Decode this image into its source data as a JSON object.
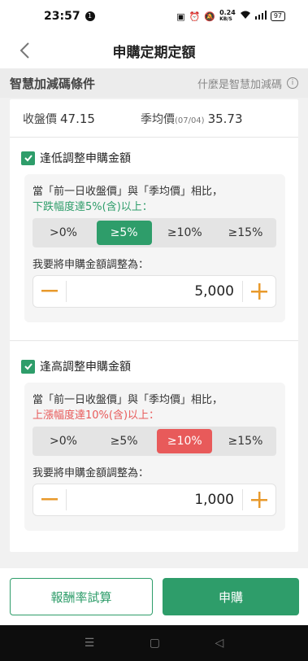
{
  "status_bar": {
    "time": "23:57",
    "notification_count": "1",
    "net_speed_value": "0.24",
    "net_speed_unit": "KB/S",
    "battery": "97"
  },
  "header": {
    "title": "申購定期定額"
  },
  "section": {
    "title": "智慧加減碼條件",
    "info_link": "什麼是智慧加減碼"
  },
  "prices": {
    "close_label": "收盤價",
    "close_value": "47.15",
    "avg_label": "季均價",
    "avg_date": "(07/04)",
    "avg_value": "35.73"
  },
  "low_condition": {
    "title": "逢低調整申購金額",
    "desc": "當「前一日收盤價」與「季均價」相比，",
    "highlight": "下跌幅度達5%(含)以上：",
    "options": [
      ">0%",
      "≥5%",
      "≥10%",
      "≥15%"
    ],
    "selected": "≥5%",
    "amount_label": "我要將申購金額調整為：",
    "amount": "5,000"
  },
  "high_condition": {
    "title": "逢高調整申購金額",
    "desc": "當「前一日收盤價」與「季均價」相比，",
    "highlight": "上漲幅度達10%(含)以上：",
    "options": [
      ">0%",
      "≥5%",
      "≥10%",
      "≥15%"
    ],
    "selected": "≥10%",
    "amount_label": "我要將申購金額調整為：",
    "amount": "1,000"
  },
  "footer": {
    "simulate_label": "報酬率試算",
    "subscribe_label": "申購"
  },
  "colors": {
    "green": "#2e9d6a",
    "red": "#e85a5a",
    "orange": "#e89a2c"
  }
}
